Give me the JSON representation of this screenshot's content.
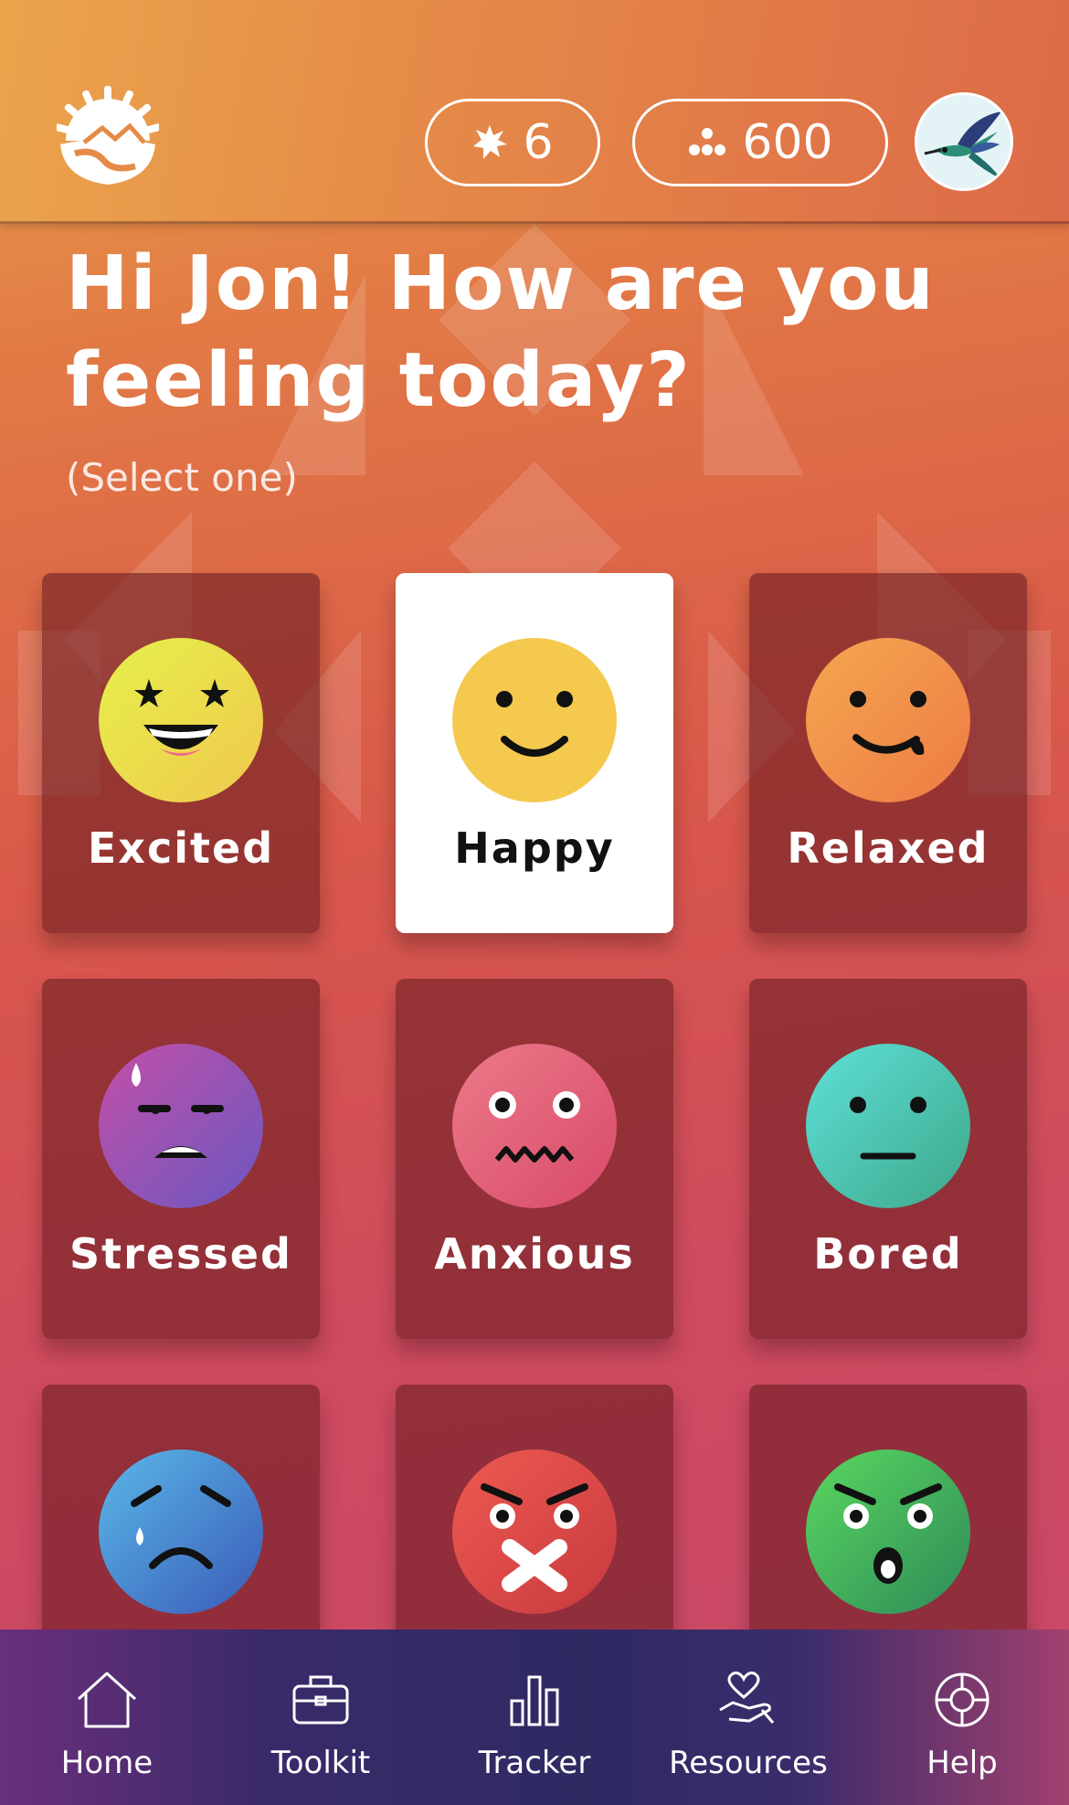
{
  "header": {
    "stars_count": "6",
    "points_count": "600"
  },
  "greeting": {
    "title": "Hi Jon! How are you feeling today?",
    "hint": "(Select one)"
  },
  "moods": [
    {
      "label": "Excited",
      "icon": "excited-face-icon",
      "color": "#f0e04a",
      "selected": false
    },
    {
      "label": "Happy",
      "icon": "happy-face-icon",
      "color": "#f4c94e",
      "selected": true
    },
    {
      "label": "Relaxed",
      "icon": "relaxed-face-icon",
      "color": "#f0944a",
      "selected": false
    },
    {
      "label": "Stressed",
      "icon": "stressed-face-icon",
      "color": "#9b55b8",
      "selected": false
    },
    {
      "label": "Anxious",
      "icon": "anxious-face-icon",
      "color": "#e0607a",
      "selected": false
    },
    {
      "label": "Bored",
      "icon": "bored-face-icon",
      "color": "#4ccab8",
      "selected": false
    },
    {
      "label": "",
      "icon": "sad-face-icon",
      "color": "#4f9ad8",
      "selected": false
    },
    {
      "label": "",
      "icon": "angry-face-icon",
      "color": "#e04848",
      "selected": false
    },
    {
      "label": "",
      "icon": "shocked-face-icon",
      "color": "#4cba62",
      "selected": false
    }
  ],
  "tabs": [
    {
      "label": "Home",
      "icon": "home-icon"
    },
    {
      "label": "Toolkit",
      "icon": "briefcase-icon"
    },
    {
      "label": "Tracker",
      "icon": "bar-chart-icon"
    },
    {
      "label": "Resources",
      "icon": "heart-hand-icon"
    },
    {
      "label": "Help",
      "icon": "lifebuoy-icon"
    }
  ],
  "colors": {
    "tabbar": "#2e2a62",
    "card": "#6e1e23",
    "selected_card": "#ffffff"
  }
}
